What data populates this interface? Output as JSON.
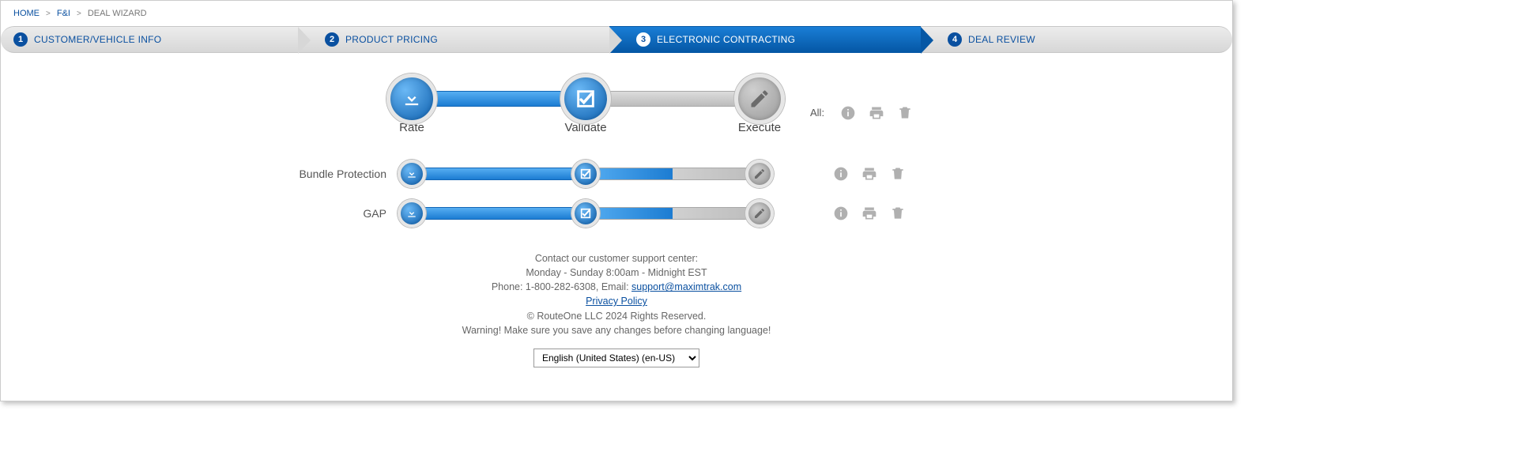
{
  "breadcrumb": {
    "home": "HOME",
    "fi": "F&I",
    "current": "DEAL WIZARD"
  },
  "wizard": {
    "steps": [
      {
        "num": "1",
        "label": "CUSTOMER/VEHICLE INFO"
      },
      {
        "num": "2",
        "label": "PRODUCT PRICING"
      },
      {
        "num": "3",
        "label": "ELECTRONIC CONTRACTING"
      },
      {
        "num": "4",
        "label": "DEAL REVIEW"
      }
    ]
  },
  "stages": {
    "rate": "Rate",
    "validate": "Validate",
    "execute": "Execute"
  },
  "all_label": "All:",
  "rows": [
    {
      "label": "Bundle Protection"
    },
    {
      "label": "GAP"
    }
  ],
  "footer": {
    "l1": "Contact our customer support center:",
    "l2": "Monday - Sunday 8:00am - Midnight EST",
    "l3a": "Phone: 1-800-282-6308, Email: ",
    "l3link": "support@maximtrak.com",
    "privacy": "Privacy Policy",
    "copyright": "© RouteOne LLC 2024 Rights Reserved.",
    "warning": "Warning! Make sure you save any changes before changing language!",
    "lang": "English (United States) (en-US)"
  }
}
